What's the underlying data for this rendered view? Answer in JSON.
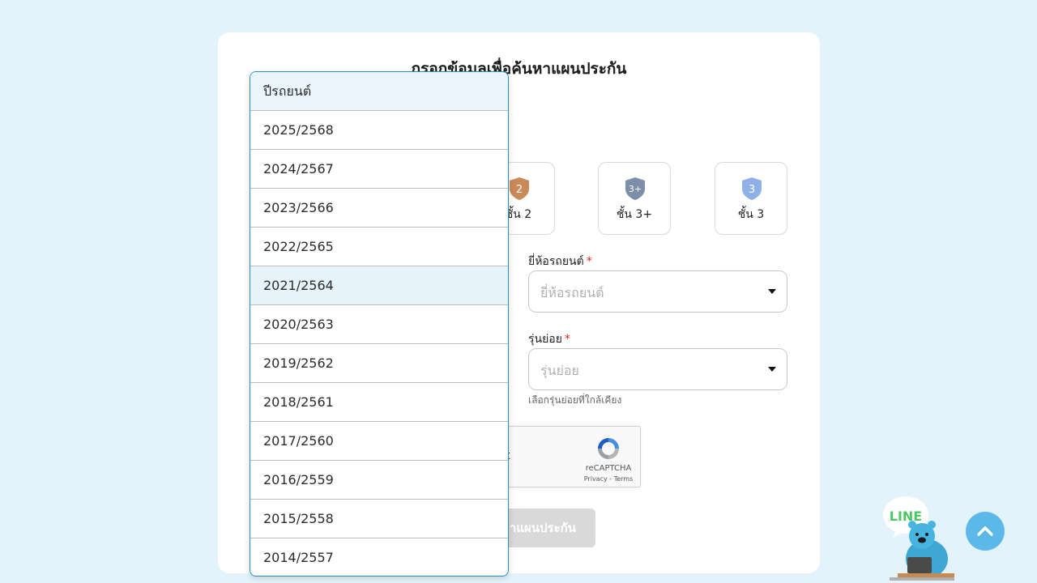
{
  "page": {
    "title": "กรอกข้อมูลเพื่อค้นหาแผนประกัน"
  },
  "tiers": [
    {
      "badge": "2",
      "label": "ชั้น 2",
      "color": "#c98958"
    },
    {
      "badge": "3+",
      "label": "ชั้น 3+",
      "color": "#7d8ea8"
    },
    {
      "badge": "3",
      "label": "ชั้น 3",
      "color": "#8fb0e6"
    }
  ],
  "brand_field": {
    "label": "ยี่ห้อรถยนต์",
    "required_mark": "*",
    "placeholder": "ยี่ห้อรถยนต์"
  },
  "submodel_field": {
    "label": "รุ่นย่อย",
    "required_mark": "*",
    "placeholder": "รุ่นย่อย",
    "hint": "เลือกรุ่นย่อยที่ใกล้เคียง"
  },
  "captcha": {
    "visible_fragment": "t",
    "brand": "reCAPTCHA",
    "links": "Privacy - Terms"
  },
  "submit": {
    "visible_label": "าแผนประกัน"
  },
  "year_dropdown": {
    "header": "ปีรถยนต์",
    "options": [
      "2025/2568",
      "2024/2567",
      "2023/2566",
      "2022/2565",
      "2021/2564",
      "2020/2563",
      "2019/2562",
      "2018/2561",
      "2017/2560",
      "2016/2559",
      "2015/2558",
      "2014/2557"
    ],
    "hovered": "2021/2564"
  },
  "widgets": {
    "line_text": "LINE"
  },
  "colors": {
    "background": "#e4f3fb",
    "accent": "#5bb8e8",
    "dropdown_border": "#2a90c2",
    "required": "#e02020",
    "line_green": "#4cc764"
  }
}
